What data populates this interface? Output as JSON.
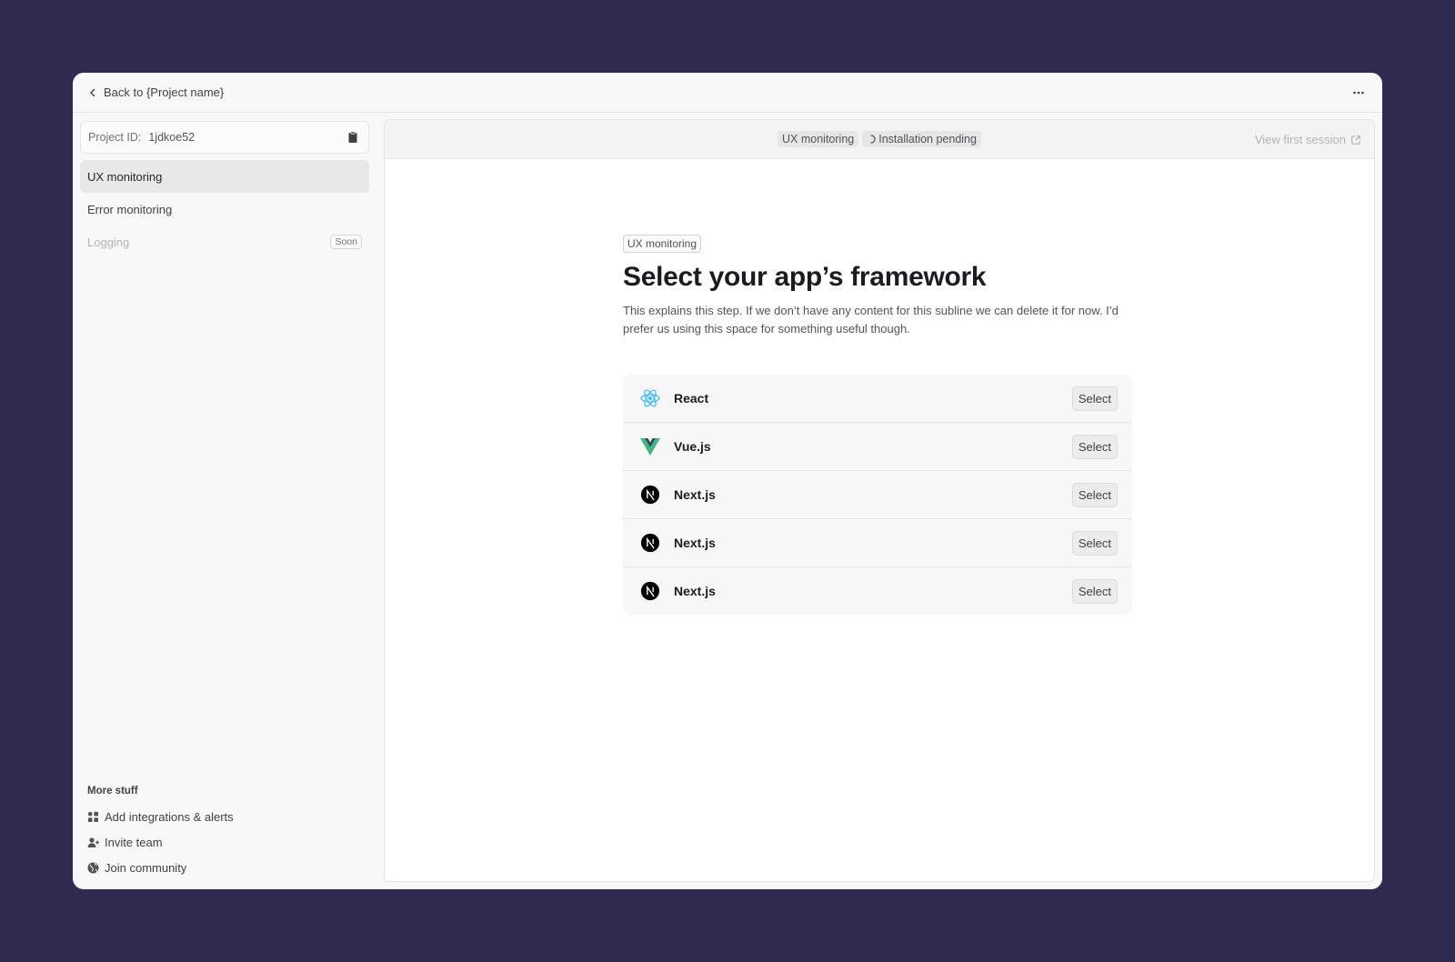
{
  "topbar": {
    "back_label": "Back to {Project name}"
  },
  "sidebar": {
    "project_id_label": "Project ID:",
    "project_id_value": "1jdkoe52",
    "items": [
      {
        "label": "UX monitoring",
        "state": "active"
      },
      {
        "label": "Error monitoring",
        "state": "normal"
      },
      {
        "label": "Logging",
        "state": "disabled",
        "badge": "Soon"
      }
    ],
    "more_stuff": {
      "heading": "More stuff",
      "links": [
        {
          "label": "Add integrations & alerts",
          "icon": "grid-icon"
        },
        {
          "label": "Invite team",
          "icon": "user-plus-icon"
        },
        {
          "label": "Join community",
          "icon": "globe-icon"
        }
      ]
    }
  },
  "main": {
    "breadcrumbs": [
      "UX monitoring",
      "Installation pending"
    ],
    "view_session_label": "View first session",
    "step_tag": "UX monitoring",
    "title": "Select your app’s framework",
    "subline": "This explains this step. If we don’t have any content for this subline we can delete it for now. I’d prefer us using this space for something useful though.",
    "frameworks": [
      {
        "name": "React",
        "icon": "react-icon",
        "button": "Select"
      },
      {
        "name": "Vue.js",
        "icon": "vue-icon",
        "button": "Select"
      },
      {
        "name": "Next.js",
        "icon": "nextjs-icon",
        "button": "Select"
      },
      {
        "name": "Next.js",
        "icon": "nextjs-icon",
        "button": "Select"
      },
      {
        "name": "Next.js",
        "icon": "nextjs-icon",
        "button": "Select"
      }
    ]
  },
  "colors": {
    "background": "#2f2a4f",
    "react": "#38bdf8",
    "vue_outer": "#41b883",
    "vue_inner": "#34495e"
  }
}
